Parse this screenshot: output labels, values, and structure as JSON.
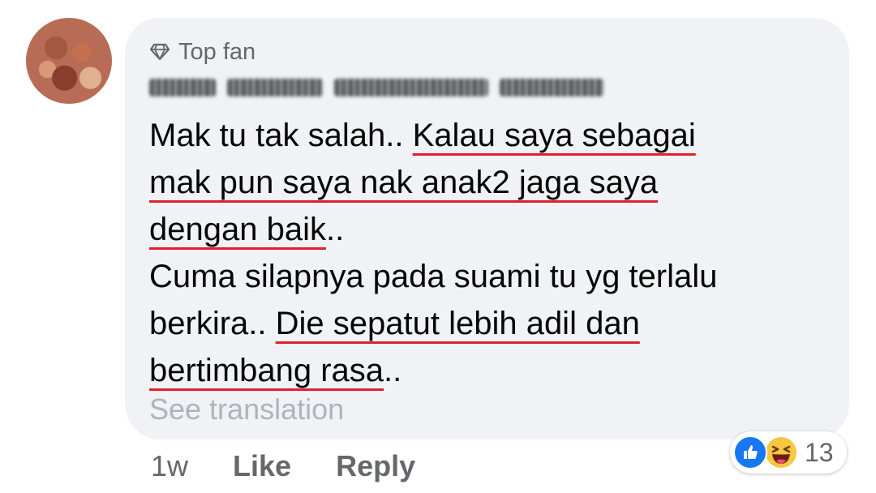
{
  "comment": {
    "badge_label": "Top fan",
    "badge_icon": "diamond-icon",
    "author_name_blurred": "",
    "lines": [
      {
        "text_plain": "Mak tu tak salah.. ",
        "text_underlined": "Kalau saya sebagai"
      },
      {
        "text_plain": "",
        "text_underlined": "mak pun saya nak anak2 jaga saya"
      },
      {
        "text_plain_after": "..",
        "text_underlined": "dengan baik"
      },
      {
        "text_plain": "Cuma silapnya pada suami tu yg terlalu",
        "text_underlined": ""
      },
      {
        "text_plain": "berkira.. ",
        "text_underlined": "Die sepatut lebih adil dan"
      },
      {
        "text_plain_after": "..",
        "text_underlined": "bertimbang rasa"
      }
    ],
    "see_translation": "See translation",
    "underline_color": "#e0202e"
  },
  "actions": {
    "time": "1w",
    "like_label": "Like",
    "reply_label": "Reply"
  },
  "reactions": {
    "types": [
      "like-icon",
      "haha-icon"
    ],
    "count": "13",
    "like_color": "#1877f2",
    "haha_color": "#f7c741"
  }
}
